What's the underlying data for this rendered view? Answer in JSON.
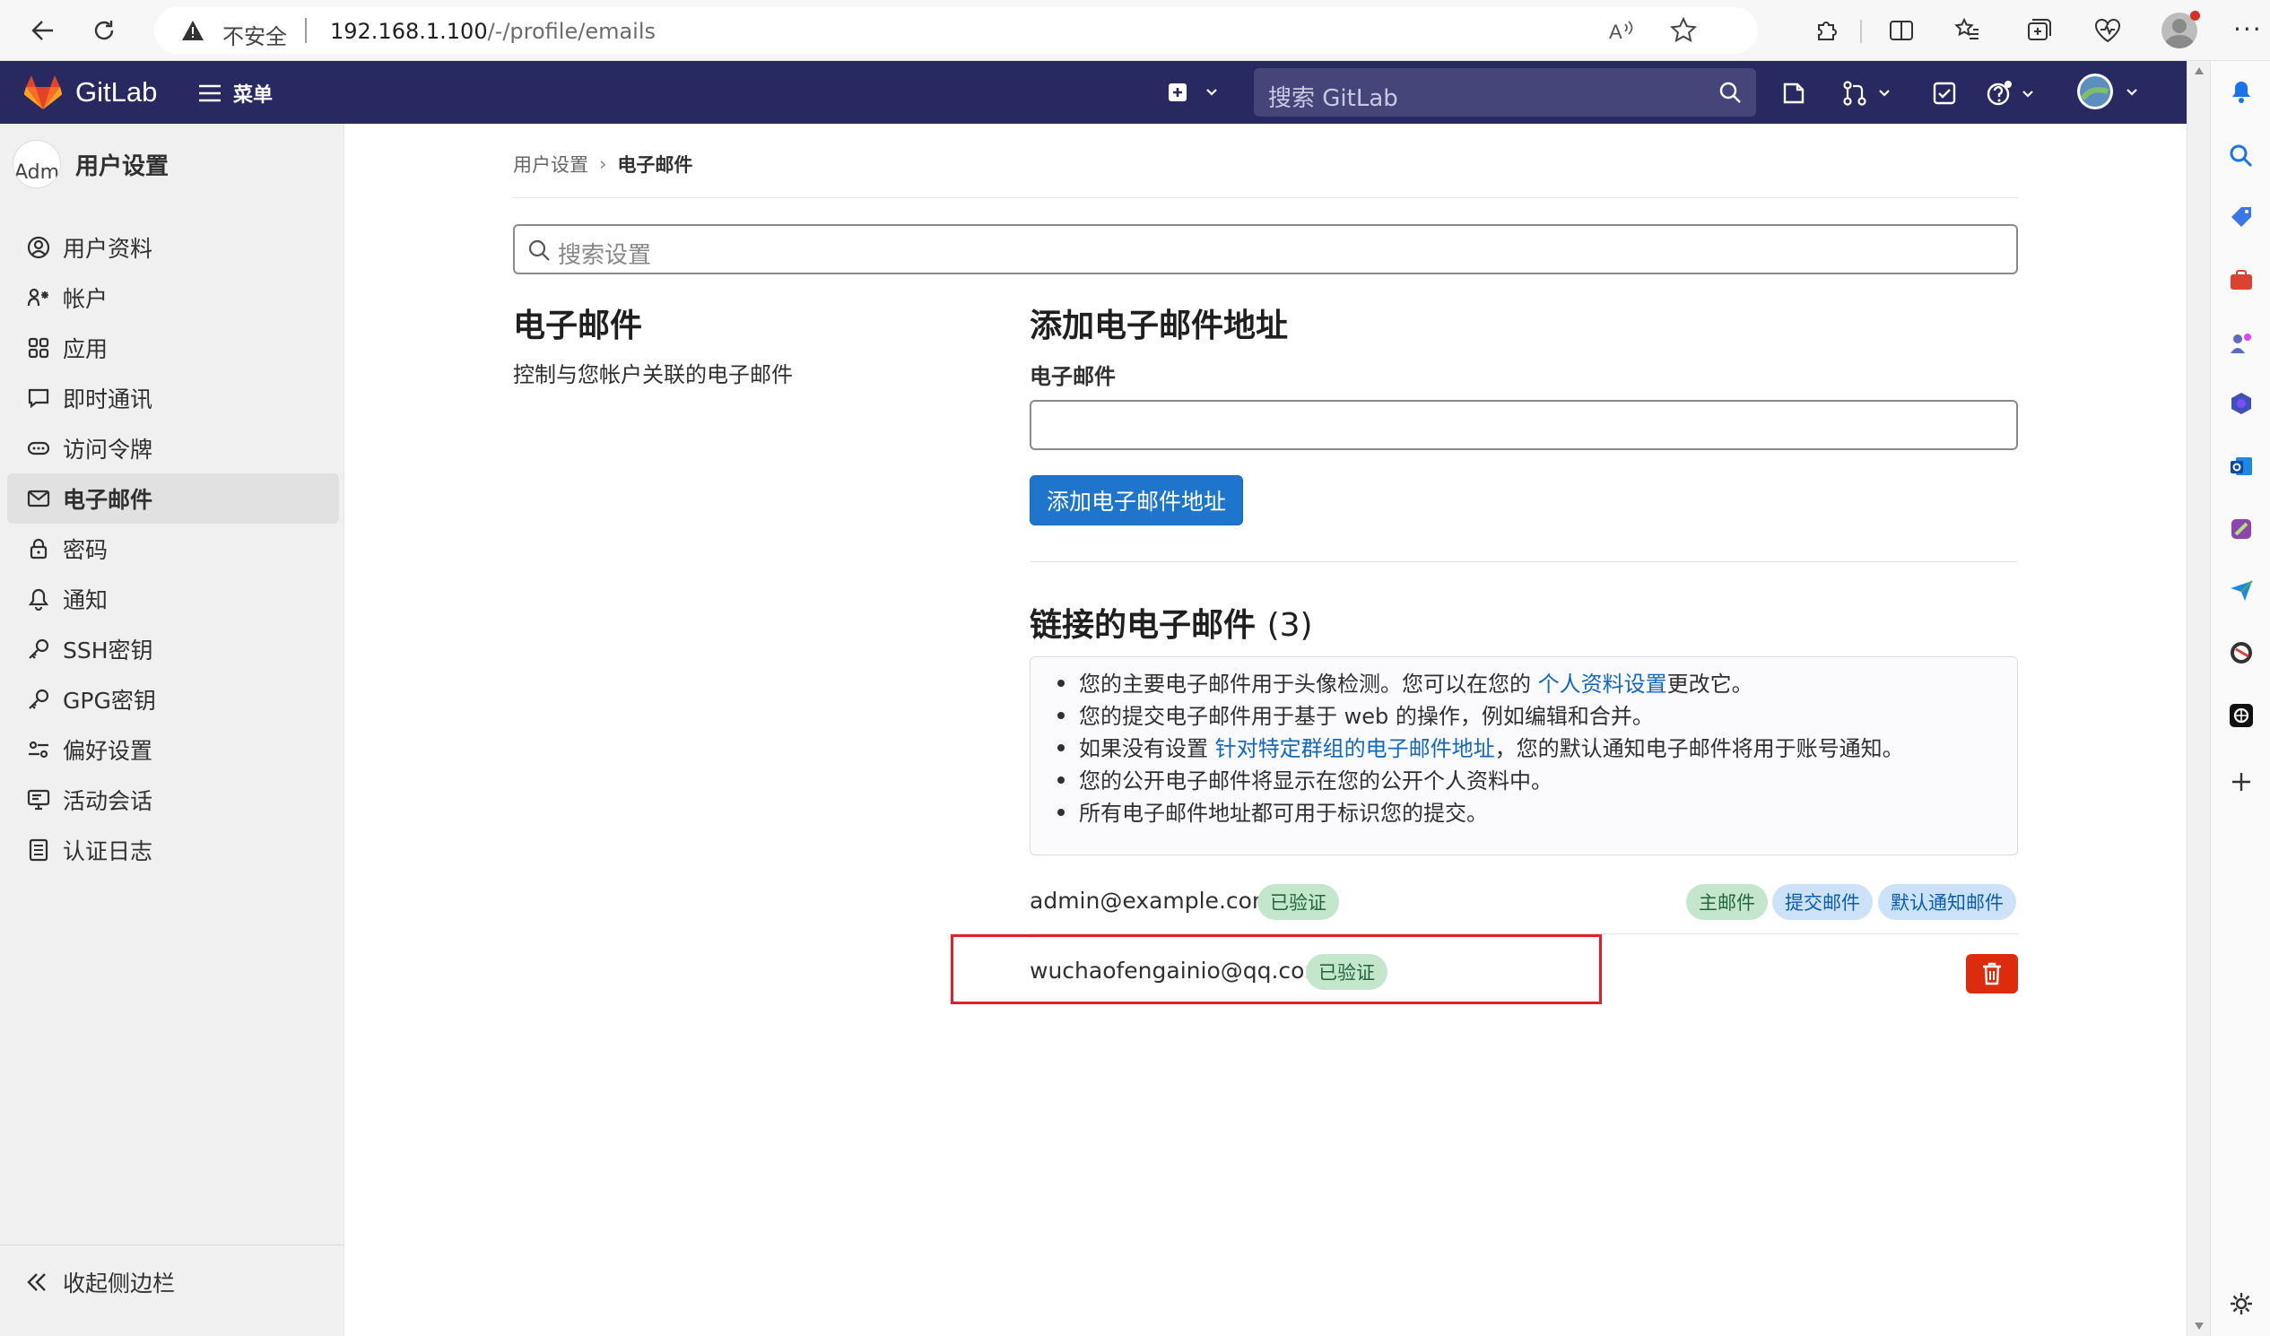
{
  "browser": {
    "insecure_label": "不安全",
    "url_host": "192.168.1.100",
    "url_path": "/-/profile/emails"
  },
  "header": {
    "brand": "GitLab",
    "menu_label": "菜单",
    "search_placeholder": "搜索 GitLab"
  },
  "sidebar": {
    "avatar_text": "Adm",
    "title": "用户设置",
    "items": [
      {
        "label": "用户资料",
        "icon": "user-circle-icon"
      },
      {
        "label": "帐户",
        "icon": "account-icon"
      },
      {
        "label": "应用",
        "icon": "applications-icon"
      },
      {
        "label": "即时通讯",
        "icon": "chat-icon"
      },
      {
        "label": "访问令牌",
        "icon": "token-icon"
      },
      {
        "label": "电子邮件",
        "icon": "mail-icon",
        "active": true
      },
      {
        "label": "密码",
        "icon": "lock-icon"
      },
      {
        "label": "通知",
        "icon": "bell-icon"
      },
      {
        "label": "SSH密钥",
        "icon": "key-icon"
      },
      {
        "label": "GPG密钥",
        "icon": "key-icon"
      },
      {
        "label": "偏好设置",
        "icon": "preferences-icon"
      },
      {
        "label": "活动会话",
        "icon": "monitor-icon"
      },
      {
        "label": "认证日志",
        "icon": "log-icon"
      }
    ],
    "collapse_label": "收起侧边栏"
  },
  "breadcrumb": {
    "parent": "用户设置",
    "current": "电子邮件"
  },
  "settings_search_placeholder": "搜索设置",
  "section": {
    "title": "电子邮件",
    "description": "控制与您帐户关联的电子邮件"
  },
  "add_email": {
    "title": "添加电子邮件地址",
    "field_label": "电子邮件",
    "field_value": "",
    "button_label": "添加电子邮件地址"
  },
  "linked": {
    "title": "链接的电子邮件",
    "count": "(3)",
    "info": {
      "line1_pre": "您的主要电子邮件用于头像检测。您可以在您的 ",
      "line1_link": "个人资料设置",
      "line1_post": "更改它。",
      "line2": "您的提交电子邮件用于基于 web 的操作，例如编辑和合并。",
      "line3_pre": "如果没有设置 ",
      "line3_link": "针对特定群组的电子邮件地址",
      "line3_post": "，您的默认通知电子邮件将用于账号通知。",
      "line4": "您的公开电子邮件将显示在您的公开个人资料中。",
      "line5": "所有电子邮件地址都可用于标识您的提交。"
    },
    "emails": [
      {
        "address": "admin@example.com",
        "status": "已验证",
        "tags": [
          "主邮件",
          "提交邮件",
          "默认通知邮件"
        ]
      },
      {
        "address": "wuchaofengainio@qq.com",
        "status": "已验证"
      }
    ]
  },
  "colors": {
    "header_bg": "#292961",
    "primary_button": "#1f75cb",
    "danger_button": "#dd2b0e",
    "highlight_border": "#e0202a",
    "verified_badge_bg": "#c3e6cd",
    "tag_badge_bg": "#cbe2f9"
  }
}
